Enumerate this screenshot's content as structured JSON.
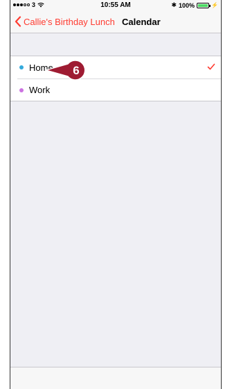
{
  "status_bar": {
    "carrier": "3",
    "time": "10:55 AM",
    "bluetooth_icon": "bluetooth-icon",
    "battery": "100%"
  },
  "nav": {
    "back_label": "Callie's Birthday Lunch",
    "title": "Calendar",
    "accent_color": "#ff3b30"
  },
  "calendars": [
    {
      "label": "Home",
      "dot_color": "#34aadc",
      "selected": true
    },
    {
      "label": "Work",
      "dot_color": "#cc73e1",
      "selected": false
    }
  ],
  "callout": {
    "number": "6",
    "color": "#9e1b32"
  }
}
